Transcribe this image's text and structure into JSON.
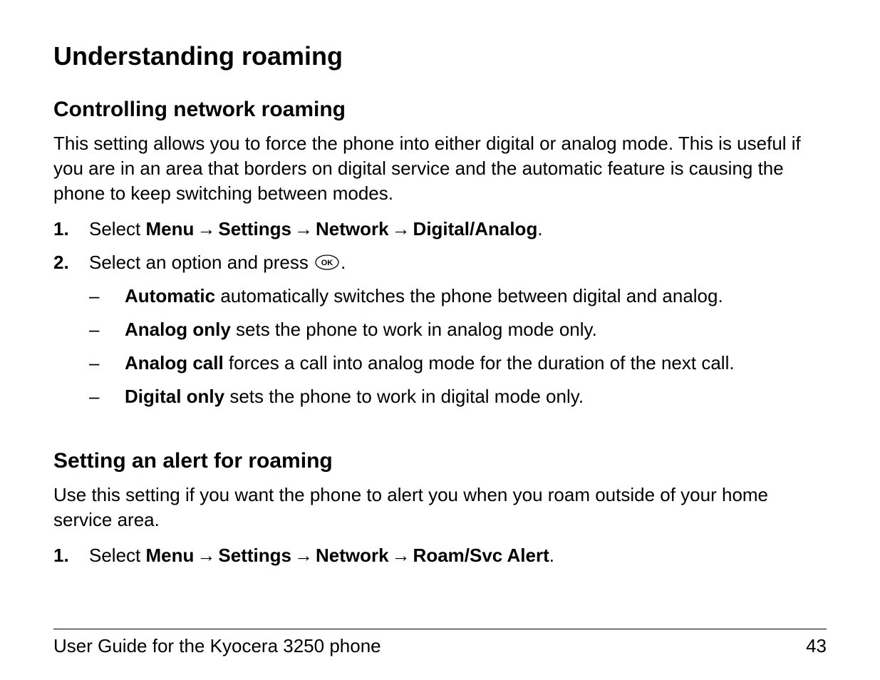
{
  "heading_main": "Understanding roaming",
  "section1": {
    "heading": "Controlling network roaming",
    "intro": "This setting allows you to force the phone into either digital or analog mode. This is useful if you are in an area that borders on digital service and the automatic feature is causing the phone to keep switching between modes.",
    "step1": {
      "num": "1.",
      "lead": "Select ",
      "menu": "Menu",
      "settings": "Settings",
      "network": "Network",
      "digital_analog": "Digital/Analog",
      "tail": "."
    },
    "step2": {
      "num": "2.",
      "lead": "Select an option and press ",
      "tail": "."
    },
    "opts": {
      "dash": "–",
      "automatic_label": "Automatic",
      "automatic_text": " automatically switches the phone between digital and analog.",
      "analog_only_label": "Analog only",
      "analog_only_text": " sets the phone to work in analog mode only.",
      "analog_call_label": "Analog call",
      "analog_call_text": " forces a call into analog mode for the duration of the next call.",
      "digital_only_label": "Digital only",
      "digital_only_text": " sets the phone to work in digital mode only."
    }
  },
  "section2": {
    "heading": "Setting an alert for roaming",
    "intro": "Use this setting if you want the phone to alert you when you roam outside of your home service area.",
    "step1": {
      "num": "1.",
      "lead": "Select ",
      "menu": "Menu",
      "settings": "Settings",
      "network": "Network",
      "roam_alert": "Roam/Svc Alert",
      "tail": "."
    }
  },
  "glyphs": {
    "arrow": "→"
  },
  "footer": {
    "title": "User Guide for the Kyocera 3250 phone",
    "page": "43"
  }
}
